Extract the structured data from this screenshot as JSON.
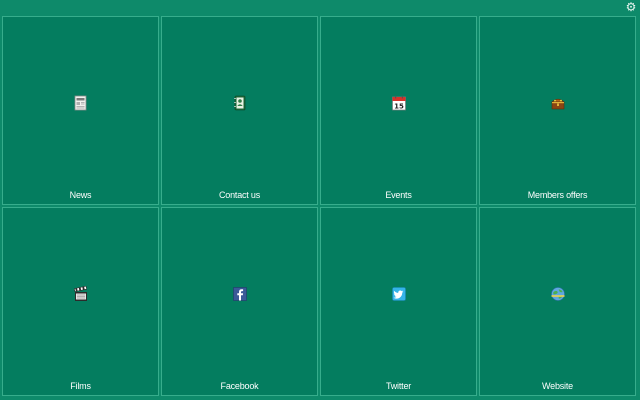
{
  "toolbar": {
    "settings_icon": "gear-icon"
  },
  "tiles": [
    {
      "label": "News",
      "icon": "newspaper-icon"
    },
    {
      "label": "Contact us",
      "icon": "address-book-icon"
    },
    {
      "label": "Events",
      "icon": "calendar-icon",
      "icon_text": "15"
    },
    {
      "label": "Members offers",
      "icon": "treasure-chest-icon"
    },
    {
      "label": "Films",
      "icon": "clapperboard-icon"
    },
    {
      "label": "Facebook",
      "icon": "facebook-icon"
    },
    {
      "label": "Twitter",
      "icon": "twitter-icon"
    },
    {
      "label": "Website",
      "icon": "globe-icon"
    }
  ],
  "colors": {
    "background": "#0e8a6a",
    "tile": "#047d5f",
    "tile_border": "#37ad8c",
    "text": "#ffffff"
  }
}
